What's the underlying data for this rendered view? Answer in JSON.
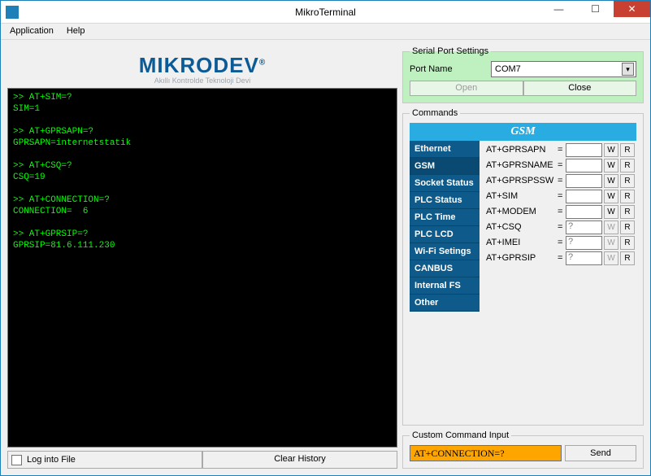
{
  "window": {
    "title": "MikroTerminal"
  },
  "menu": {
    "application": "Application",
    "help": "Help"
  },
  "logo": {
    "main": "MIKRODEV",
    "reg": "®",
    "sub": "Akıllı Kontrolde Teknoloji Devi"
  },
  "terminal": {
    "lines": [
      ">> AT+SIM=?",
      "SIM=1",
      "",
      ">> AT+GPRSAPN=?",
      "GPRSAPN=internetstatik",
      "",
      ">> AT+CSQ=?",
      "CSQ=19",
      "",
      ">> AT+CONNECTION=?",
      "CONNECTION=  6",
      "",
      ">> AT+GPRSIP=?",
      "GPRSIP=81.6.111.230"
    ]
  },
  "log_checkbox": "Log into File",
  "clear_history": "Clear History",
  "serial": {
    "legend": "Serial Port Settings",
    "port_name_label": "Port Name",
    "port_name_value": "COM7",
    "open": "Open",
    "close": "Close"
  },
  "commands": {
    "legend": "Commands",
    "header": "GSM",
    "tabs": [
      "Ethernet",
      "GSM",
      "Socket Status",
      "PLC Status",
      "PLC Time",
      "PLC LCD",
      "Wi-Fi Setings",
      "CANBUS",
      "Internal FS",
      "Other"
    ],
    "active_tab": "GSM",
    "rows": [
      {
        "label": "AT+GPRSAPN",
        "value": "",
        "w_enabled": true,
        "r_enabled": true
      },
      {
        "label": "AT+GPRSNAME",
        "value": "",
        "w_enabled": true,
        "r_enabled": true
      },
      {
        "label": "AT+GPRSPSSW",
        "value": "",
        "w_enabled": true,
        "r_enabled": true
      },
      {
        "label": "AT+SIM",
        "value": "",
        "w_enabled": true,
        "r_enabled": true
      },
      {
        "label": "AT+MODEM",
        "value": "",
        "w_enabled": true,
        "r_enabled": true
      },
      {
        "label": "AT+CSQ",
        "value": "?",
        "w_enabled": false,
        "r_enabled": true
      },
      {
        "label": "AT+IMEI",
        "value": "?",
        "w_enabled": false,
        "r_enabled": true
      },
      {
        "label": "AT+GPRSIP",
        "value": "?",
        "w_enabled": false,
        "r_enabled": true
      }
    ],
    "w": "W",
    "r": "R"
  },
  "custom": {
    "legend": "Custom Command Input",
    "value": "AT+CONNECTION=?",
    "send": "Send"
  }
}
